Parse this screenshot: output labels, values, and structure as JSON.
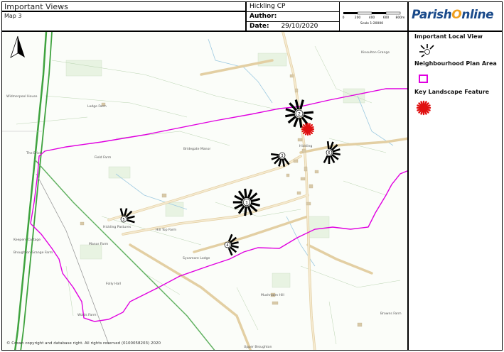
{
  "title": "Important Views",
  "map_label": "Map 3",
  "parish": "Hickling CP",
  "author_label": "Author:",
  "author_value": "",
  "date_label": "Date:",
  "date_value": "29/10/2020",
  "scale_ticks": [
    "0",
    "200",
    "400",
    "600",
    "800m"
  ],
  "scale_text": "Scale 1:20000",
  "logo": {
    "part1": "Parish",
    "part2": "nline",
    "o": "O"
  },
  "legend": {
    "view": "Important Local View",
    "plan_area": "Neighbourhood Plan Area",
    "landscape": "Key Landscape Feature"
  },
  "copyright": "© Crown copyright and database right. All rights reserved (0100058203) 2020",
  "place_labels": {
    "lodge_farm": "Lodge Farm",
    "field_farm": "Field Farm",
    "bridegate": "Bridegate Manor",
    "hickling": "Hickling",
    "hickling_pastures": "Hickling Pastures",
    "hill_top": "Hill Top Farm",
    "manor_farm": "Manor Farm",
    "sycamore": "Sycamore Lodge",
    "folly_hall": "Folly Hall",
    "wolds_farm": "Wolds Farm",
    "mushroom": "Mushroom Hill",
    "kinoulton": "Kinoulton Grange",
    "broughton": "Broughton Grange Farm",
    "keepers": "Keepers Cottage",
    "widmerpool": "Widmerpool House",
    "upper_broughton": "Upper Broughton",
    "browns": "Browns Farm",
    "the_brick": "The Brick"
  },
  "view_numbers": [
    "1",
    "2",
    "3",
    "4",
    "5",
    "6",
    "7"
  ],
  "colors": {
    "boundary": "#e000e0",
    "feature": "#e01010",
    "road": "#f5e6c8",
    "water": "#9ecae1",
    "railway": "#3fa33f"
  }
}
